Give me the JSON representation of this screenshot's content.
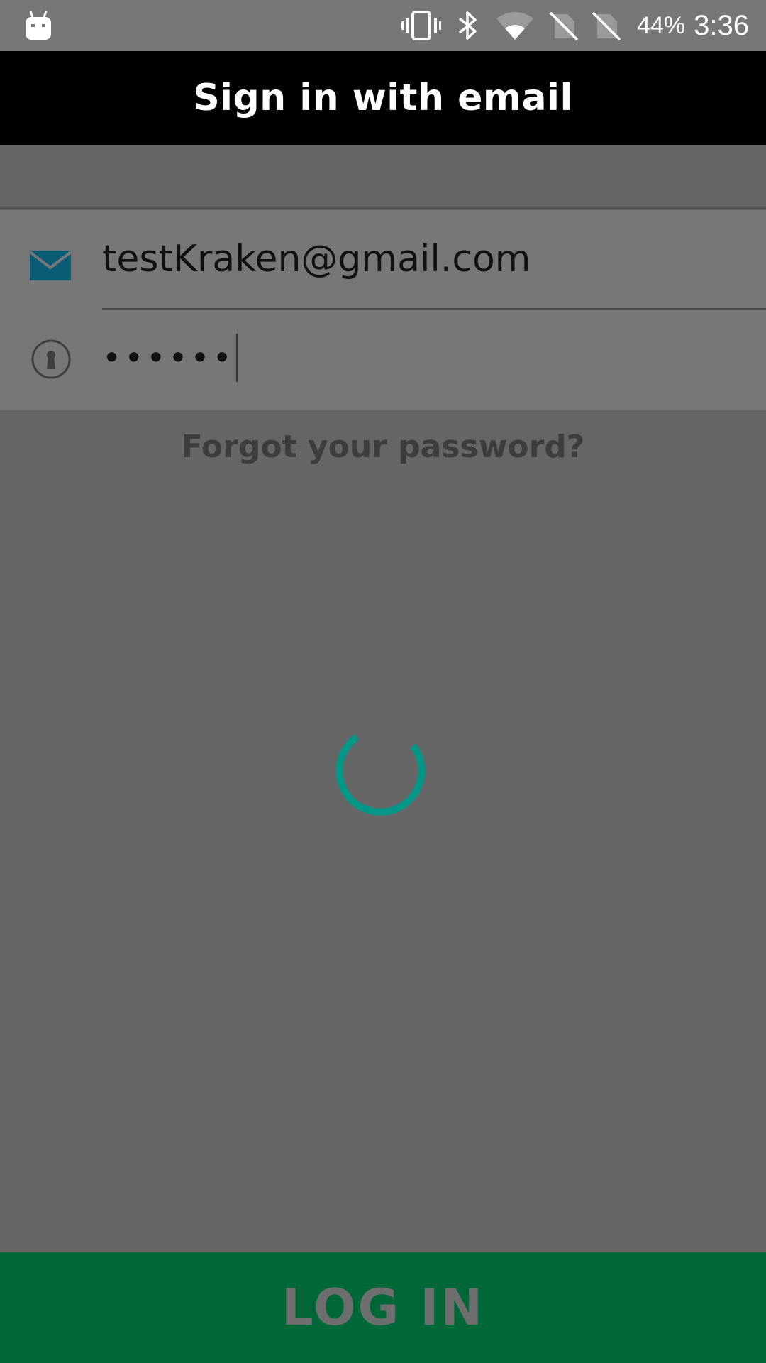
{
  "status_bar": {
    "battery": "44%",
    "time": "3:36",
    "icons": [
      "android-debug-icon",
      "vibrate-icon",
      "bluetooth-icon",
      "wifi-icon",
      "no-sim-icon",
      "no-sim-icon"
    ]
  },
  "app_bar": {
    "title": "Sign in with email"
  },
  "form": {
    "email_value": "testKraken@gmail.com",
    "password_masked": "••••••",
    "email_icon_color": "#0a5c75"
  },
  "links": {
    "forgot_password": "Forgot your password?"
  },
  "loading": {
    "spinner_color": "#009688"
  },
  "footer": {
    "login_label": "LOG IN",
    "login_bg": "#006838"
  }
}
